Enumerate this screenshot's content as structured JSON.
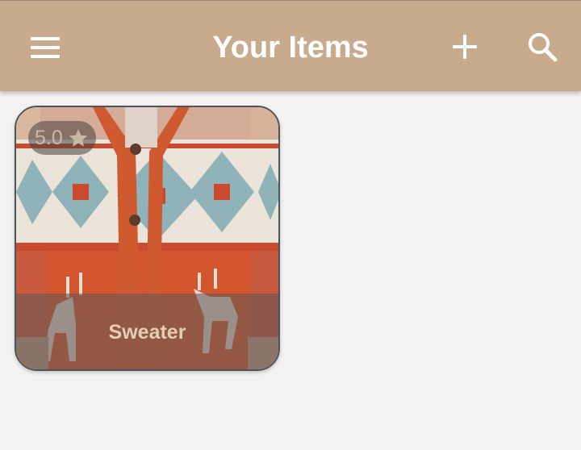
{
  "app_bar": {
    "title": "Your Items",
    "menu_icon": "menu-icon",
    "add_icon": "add-icon",
    "search_icon": "search-icon",
    "background_color": "#c8ab8d"
  },
  "items": [
    {
      "name": "Sweater",
      "rating": "5.0",
      "rating_icon": "star-icon",
      "image": "red and cream nordic reindeer cardigan sweater"
    }
  ]
}
